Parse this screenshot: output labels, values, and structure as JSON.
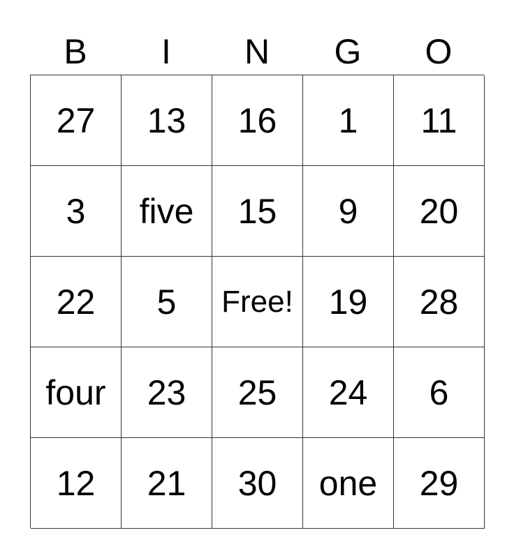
{
  "header": [
    "B",
    "I",
    "N",
    "G",
    "O"
  ],
  "rows": [
    [
      "27",
      "13",
      "16",
      "1",
      "11"
    ],
    [
      "3",
      "five",
      "15",
      "9",
      "20"
    ],
    [
      "22",
      "5",
      "Free!",
      "19",
      "28"
    ],
    [
      "four",
      "23",
      "25",
      "24",
      "6"
    ],
    [
      "12",
      "21",
      "30",
      "one",
      "29"
    ]
  ]
}
